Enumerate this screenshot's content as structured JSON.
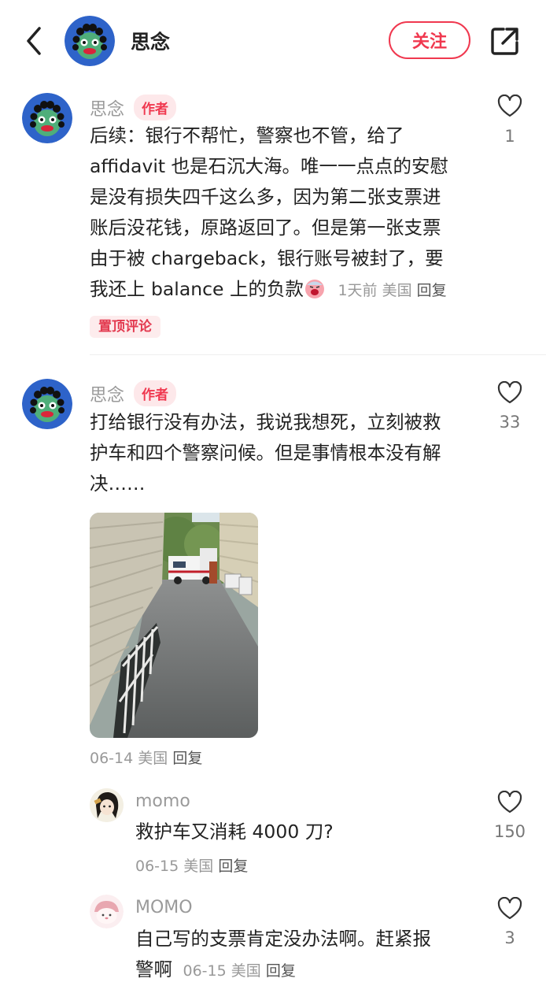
{
  "header": {
    "title": "思念",
    "follow_label": "关注"
  },
  "comments": [
    {
      "username": "思念",
      "author_tag": "作者",
      "lines": [
        "后续：银行不帮忙，警察也不管，给了",
        "affidavit 也是石沉大海。唯一一点点的安慰",
        "是没有损失四千这么多，因为第二张支票进",
        "账后没花钱，原路返回了。但是第一张支票",
        "由于被 chargeback，银行账号被封了，要",
        "我还上 balance 上的负款"
      ],
      "time": "1天前",
      "location": "美国",
      "reply": "回复",
      "pin_tag": "置顶评论",
      "likes": "1"
    },
    {
      "username": "思念",
      "author_tag": "作者",
      "lines": [
        "打给银行没有办法，我说我想死，立刻被救",
        "护车和四个警察问候。但是事情根本没有解",
        "决……"
      ],
      "time": "06-14",
      "location": "美国",
      "reply": "回复",
      "likes": "33"
    }
  ],
  "replies": [
    {
      "username": "momo",
      "text": "救护车又消耗 4000 刀?",
      "time": "06-15",
      "location": "美国",
      "reply": "回复",
      "likes": "150"
    },
    {
      "username": "MOMO",
      "lines": [
        "自己写的支票肯定没办法啊。赶紧报",
        "警啊"
      ],
      "time": "06-15",
      "location": "美国",
      "reply": "回复",
      "likes": "3"
    }
  ],
  "colors": {
    "accent": "#f0384f",
    "avatar_bg": "#2e63c9",
    "avatar_face": "#4fae7a"
  }
}
